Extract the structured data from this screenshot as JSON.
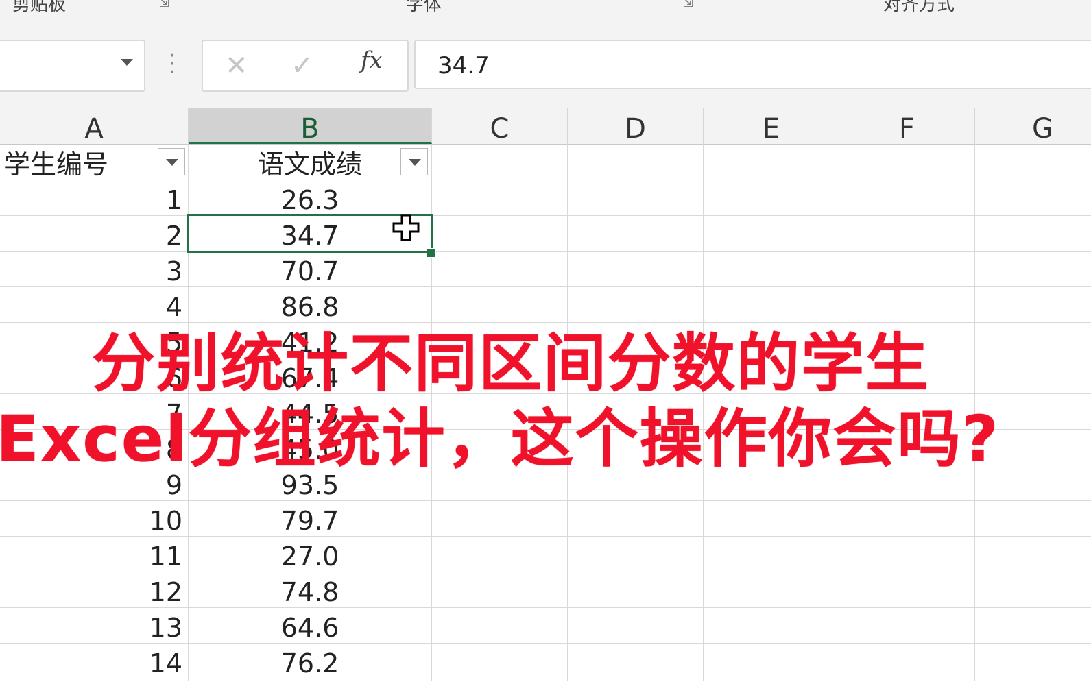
{
  "ribbon": {
    "groups": [
      "剪贴板",
      "字体",
      "对齐方式"
    ]
  },
  "formula_bar": {
    "name_box": "",
    "cancel_glyph": "✕",
    "enter_glyph": "✓",
    "fx_label": "fx",
    "value": "34.7"
  },
  "columns": [
    "A",
    "B",
    "C",
    "D",
    "E",
    "F",
    "G"
  ],
  "table": {
    "header": [
      "学生编号",
      "语文成绩"
    ],
    "rows": [
      {
        "id": "1",
        "score": "26.3"
      },
      {
        "id": "2",
        "score": "34.7"
      },
      {
        "id": "3",
        "score": "70.7"
      },
      {
        "id": "4",
        "score": "86.8"
      },
      {
        "id": "5",
        "score": "41.2"
      },
      {
        "id": "6",
        "score": "67.4"
      },
      {
        "id": "7",
        "score": "44.5"
      },
      {
        "id": "8",
        "score": "45.0"
      },
      {
        "id": "9",
        "score": "93.5"
      },
      {
        "id": "10",
        "score": "79.7"
      },
      {
        "id": "11",
        "score": "27.0"
      },
      {
        "id": "12",
        "score": "74.8"
      },
      {
        "id": "13",
        "score": "64.6"
      },
      {
        "id": "14",
        "score": "76.2"
      }
    ]
  },
  "caption": {
    "line1": "分别统计不同区间分数的学生",
    "line2": "Excel分组统计，这个操作你会吗?"
  },
  "colors": {
    "accent": "#217346",
    "caption": "#f0112a"
  }
}
